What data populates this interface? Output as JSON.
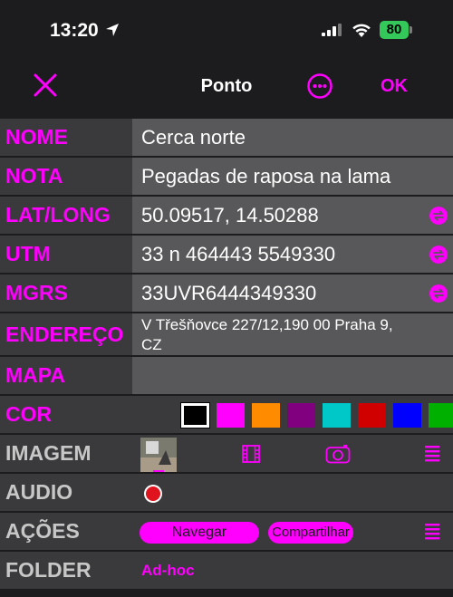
{
  "status_bar": {
    "time": "13:20",
    "battery": "80"
  },
  "navbar": {
    "title": "Ponto",
    "ok_label": "OK",
    "close_icon": "close-icon",
    "more_icon": "more-icon"
  },
  "accent_color": "#ff00ff",
  "fields": {
    "nome": {
      "label": "NOME",
      "value": "Cerca norte"
    },
    "nota": {
      "label": "NOTA",
      "value": "Pegadas de raposa na lama"
    },
    "latlong": {
      "label": "LAT/LONG",
      "value": "50.09517, 14.50288"
    },
    "utm": {
      "label": "UTM",
      "value": "33 n 464443 5549330"
    },
    "mgrs": {
      "label": "MGRS",
      "value": "33UVR6444349330"
    },
    "endereco": {
      "label": "ENDEREÇO",
      "value": "V Třešňovce 227/12,190 00 Praha 9, CZ"
    },
    "mapa": {
      "label": "MAPA"
    },
    "cor": {
      "label": "COR",
      "colors": [
        "#000000",
        "#ff00ff",
        "#ff8c00",
        "#800080",
        "#00c8c8",
        "#d00000",
        "#0000ff",
        "#00b000"
      ],
      "selected_index": 0
    },
    "imagem": {
      "label": "IMAGEM"
    },
    "audio": {
      "label": "AUDIO"
    },
    "acoes": {
      "label": "AÇÕES",
      "navegar": "Navegar",
      "compartilhar": "Compartilhar"
    },
    "folder": {
      "label": "FOLDER",
      "value": "Ad-hoc"
    }
  }
}
